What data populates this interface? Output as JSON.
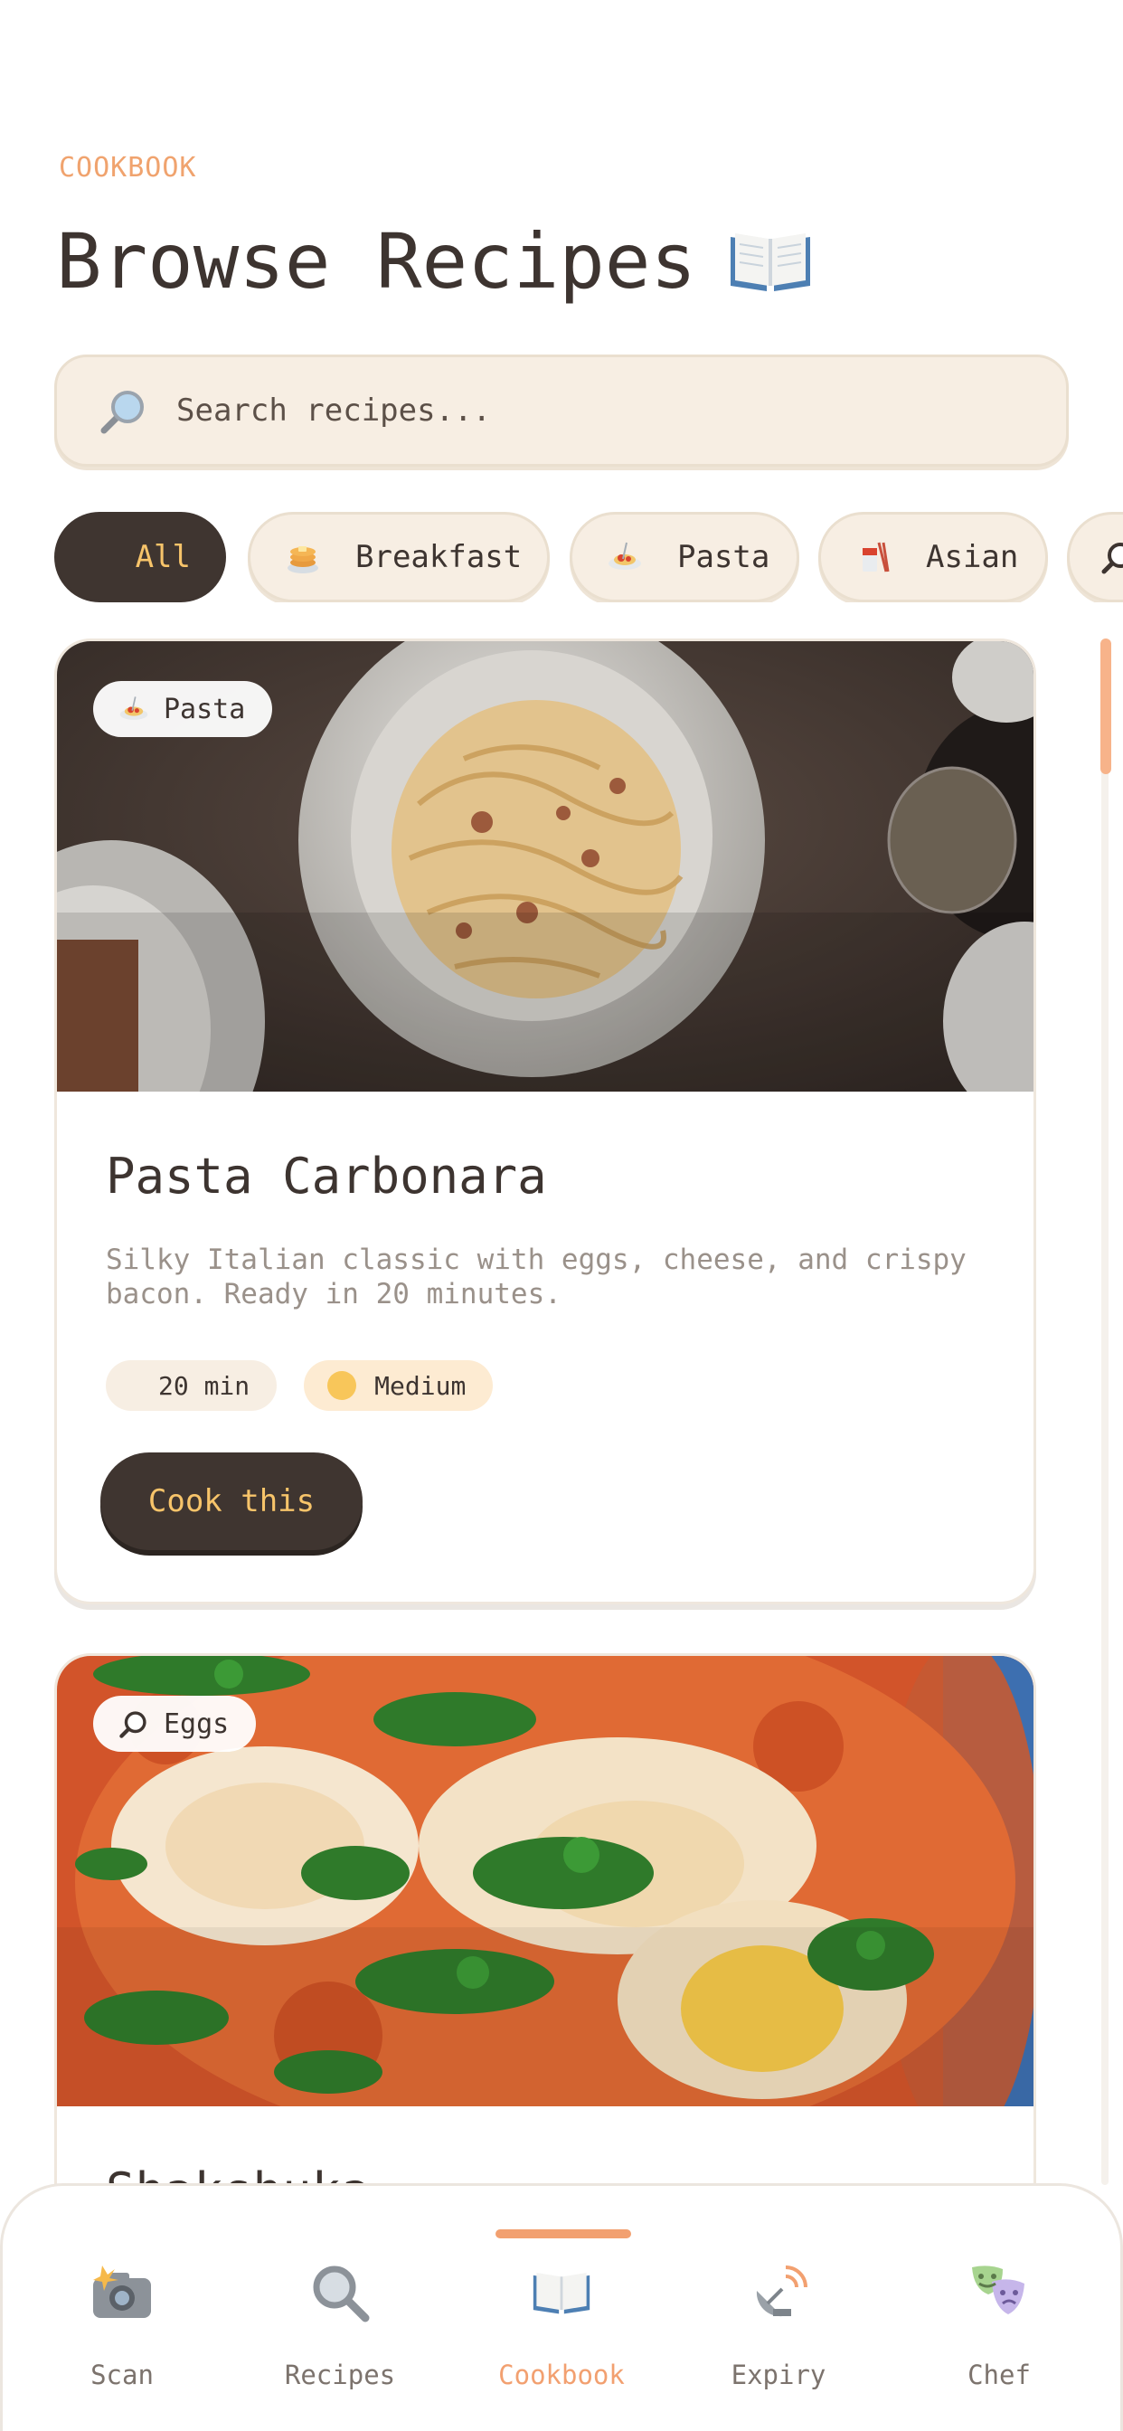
{
  "header": {
    "eyebrow": "COOKBOOK",
    "title": "Browse Recipes",
    "title_icon": "open-book-icon"
  },
  "search": {
    "placeholder": "Search recipes...",
    "icon": "magnifier-icon"
  },
  "filters": [
    {
      "label": "All",
      "icon": "",
      "active": true
    },
    {
      "label": "Breakfast",
      "icon": "pancakes-icon",
      "active": false
    },
    {
      "label": "Pasta",
      "icon": "spaghetti-icon",
      "active": false
    },
    {
      "label": "Asian",
      "icon": "asian-food-icon",
      "active": false
    },
    {
      "label": "",
      "icon": "magnifier-icon",
      "active": false
    }
  ],
  "recipes": [
    {
      "category": "Pasta",
      "category_icon": "spaghetti-icon",
      "title": "Pasta Carbonara",
      "description": "Silky Italian classic with eggs, cheese, and crispy bacon. Ready in 20 minutes.",
      "time": "20 min",
      "difficulty": "Medium",
      "action": "Cook this"
    },
    {
      "category": "Eggs",
      "category_icon": "magnifier-icon",
      "title": "Shakshuka"
    }
  ],
  "nav": {
    "items": [
      {
        "label": "Scan",
        "icon": "camera-flash-icon",
        "active": false
      },
      {
        "label": "Recipes",
        "icon": "magnifier-icon",
        "active": false
      },
      {
        "label": "Cookbook",
        "icon": "open-book-icon",
        "active": true
      },
      {
        "label": "Expiry",
        "icon": "satellite-dish-icon",
        "active": false
      },
      {
        "label": "Chef",
        "icon": "theater-masks-icon",
        "active": false
      }
    ]
  },
  "colors": {
    "accent": "#f2a070",
    "dark": "#3f3530",
    "gold": "#f7c46a",
    "cream": "#f7eee3"
  }
}
